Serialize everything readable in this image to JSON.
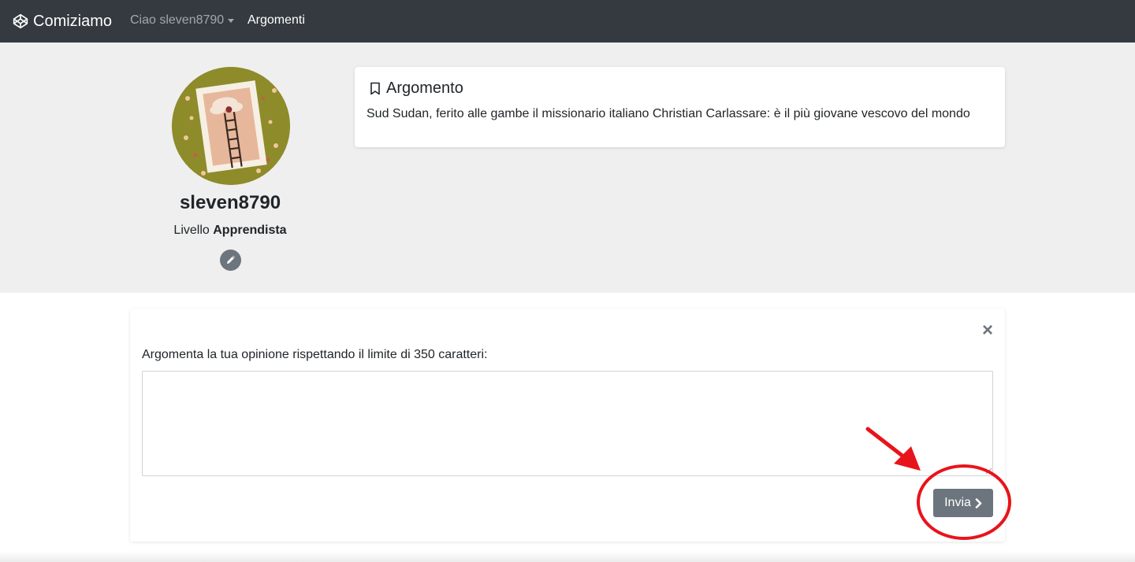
{
  "navbar": {
    "brand": "Comiziamo",
    "brand_icon": "codepen-cube-icon",
    "user_menu": "Ciao sleven8790",
    "link": "Argomenti"
  },
  "profile": {
    "username": "sleven8790",
    "level_prefix": "Livello",
    "level_value": "Apprendista",
    "avatar_icon": "avatar-illustration-ladder",
    "edit_icon": "pencil-icon"
  },
  "topic": {
    "title": "Argomento",
    "title_icon": "bookmark-icon",
    "text": "Sud Sudan, ferito alle gambe il missionario italiano Christian Carlassare: è il più giovane vescovo del mondo"
  },
  "form": {
    "close_label": "×",
    "label": "Argomenta la tua opinione rispettando il limite di 350 caratteri:",
    "textarea_value": "",
    "submit_label": "Invia",
    "submit_icon": "chevron-right-icon"
  },
  "colors": {
    "navbar_bg": "#343a40",
    "jumbo_bg": "#efefef",
    "button_bg": "#6c757d",
    "annotation_red": "#e8141b"
  }
}
